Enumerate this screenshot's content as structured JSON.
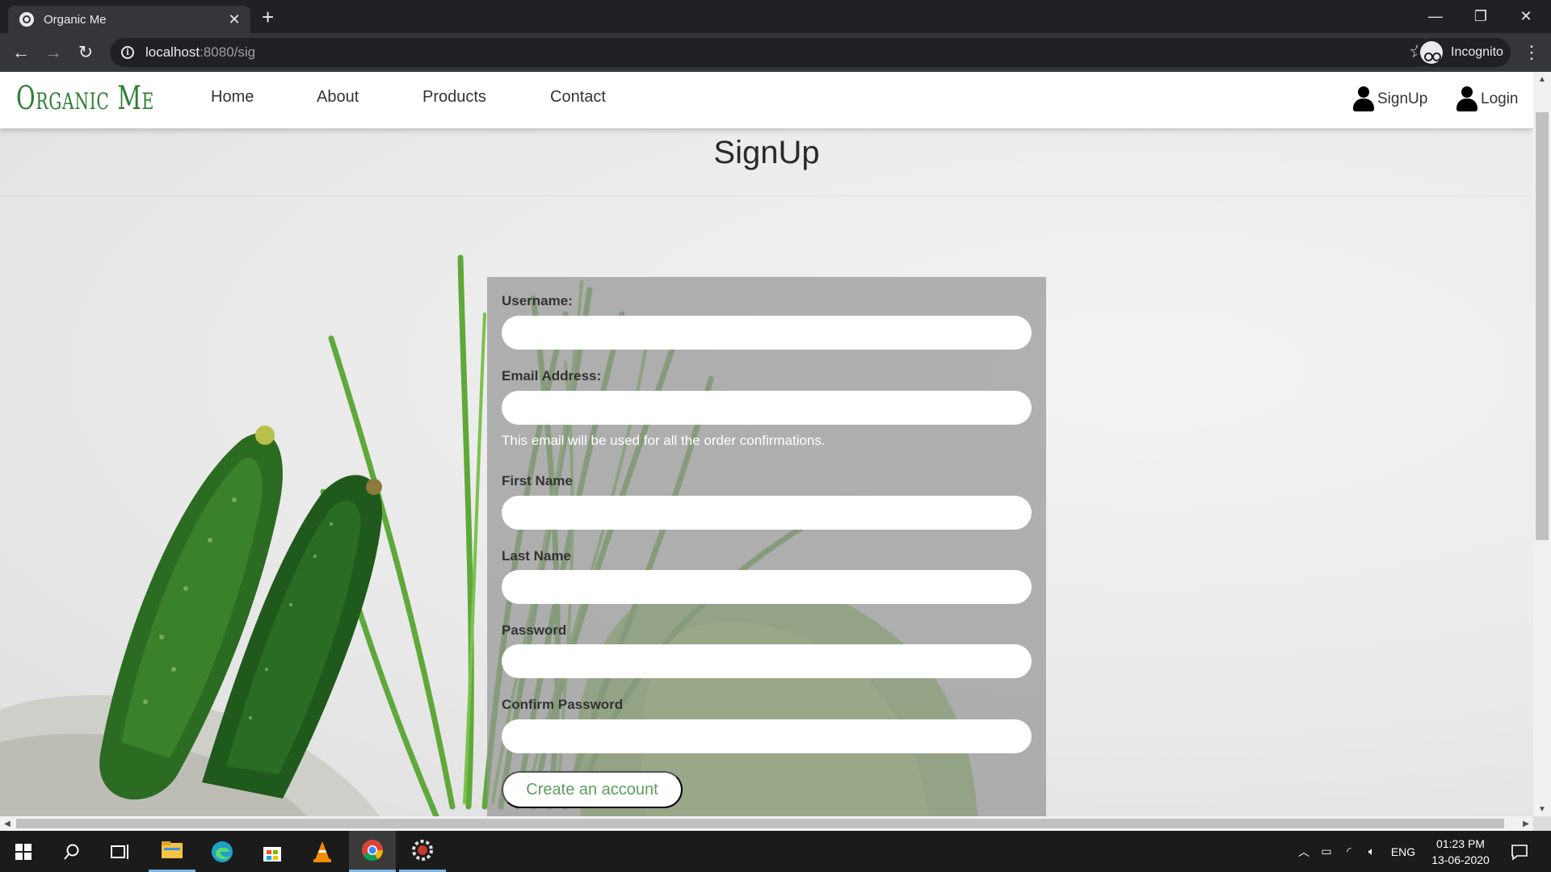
{
  "browser": {
    "tab_title": "Organic Me",
    "url_host": "localhost",
    "url_rest": ":8080/sig",
    "incognito_label": "Incognito"
  },
  "site": {
    "brand": "Organic Me",
    "nav": [
      "Home",
      "About",
      "Products",
      "Contact"
    ],
    "signup_link": "SignUp",
    "login_link": "Login"
  },
  "page": {
    "title": "SignUp"
  },
  "form": {
    "username_label": "Username:",
    "username_value": "",
    "email_label": "Email Address:",
    "email_value": "",
    "email_hint": "This email will be used for all the order confirmations.",
    "firstname_label": "First Name",
    "firstname_value": "",
    "lastname_label": "Last Name",
    "lastname_value": "",
    "password_label": "Password",
    "password_value": "",
    "confirm_label": "Confirm Password",
    "confirm_value": "",
    "submit_label": "Create an account"
  },
  "taskbar": {
    "language": "ENG",
    "time": "01:23 PM",
    "date": "13-06-2020"
  },
  "colors": {
    "brand_green": "#2e7d32",
    "button_text": "#5c9e5c",
    "browser_dark": "#202124"
  }
}
